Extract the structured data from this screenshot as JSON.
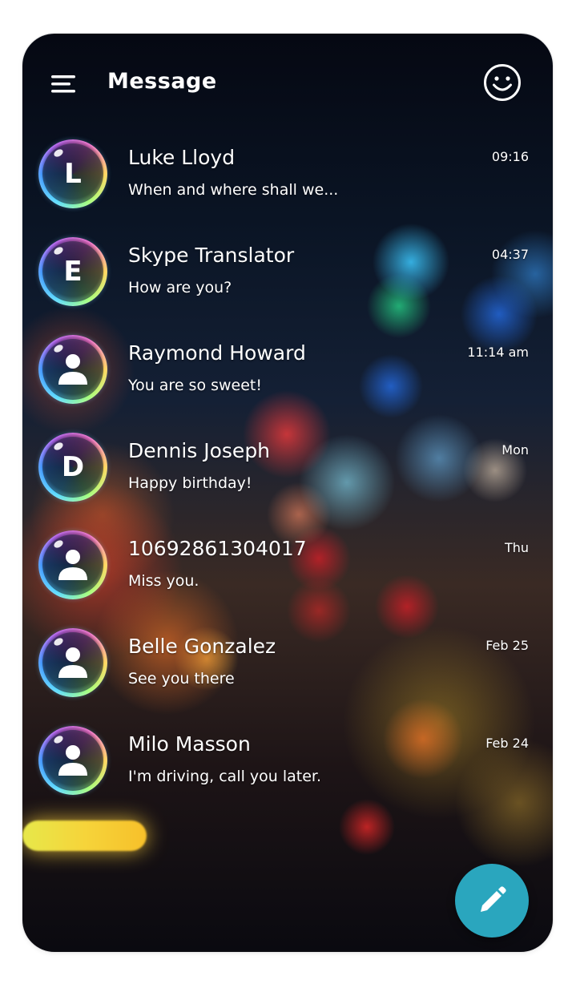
{
  "header": {
    "title": "Message",
    "menu_icon": "hamburger-menu-icon",
    "profile_icon": "smiley-face-icon"
  },
  "conversations": [
    {
      "name": "Luke Lloyd",
      "preview": "When and where shall we...",
      "time": "09:16",
      "avatar": {
        "type": "letter",
        "letter": "L"
      }
    },
    {
      "name": "Skype Translator",
      "preview": "How are you?",
      "time": "04:37",
      "avatar": {
        "type": "letter",
        "letter": "E"
      }
    },
    {
      "name": "Raymond Howard",
      "preview": "You are so sweet!",
      "time": "11:14 am",
      "avatar": {
        "type": "person",
        "letter": ""
      }
    },
    {
      "name": "Dennis Joseph",
      "preview": "Happy birthday!",
      "time": "Mon",
      "avatar": {
        "type": "letter",
        "letter": "D"
      }
    },
    {
      "name": "10692861304017",
      "preview": "Miss you.",
      "time": "Thu",
      "avatar": {
        "type": "person",
        "letter": ""
      }
    },
    {
      "name": "Belle Gonzalez",
      "preview": "See you there",
      "time": "Feb 25",
      "avatar": {
        "type": "person",
        "letter": ""
      }
    },
    {
      "name": "Milo Masson",
      "preview": "I'm driving, call you later.",
      "time": "Feb 24",
      "avatar": {
        "type": "person",
        "letter": ""
      }
    }
  ],
  "fab": {
    "icon": "pencil-compose-icon",
    "color": "#2aa6be"
  },
  "colors": {
    "text": "#ffffff",
    "accent": "#2aa6be"
  }
}
